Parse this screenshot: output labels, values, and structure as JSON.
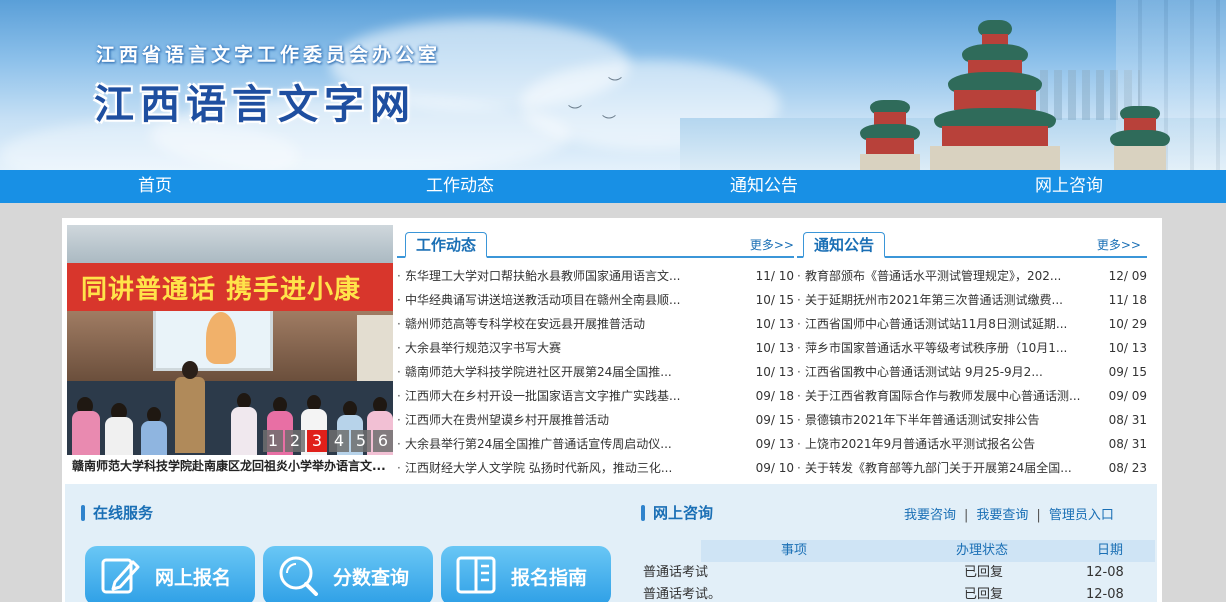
{
  "banner": {
    "subtitle": "江西省语言文字工作委员会办公室",
    "title": "江西语言文字网"
  },
  "nav": {
    "items": [
      {
        "label": "首页"
      },
      {
        "label": "工作动态"
      },
      {
        "label": "通知公告"
      },
      {
        "label": "网上咨询"
      }
    ]
  },
  "slideshow": {
    "banner_text": "同讲普通话  携手进小康",
    "pages": [
      "1",
      "2",
      "3",
      "4",
      "5",
      "6"
    ],
    "active_page": "3",
    "caption": "赣南师范大学科技学院赴南康区龙回祖炎小学举办语言文..."
  },
  "work_news": {
    "title": "工作动态",
    "more": "更多>>",
    "items": [
      {
        "title": "东华理工大学对口帮扶鲐水县教师国家通用语言文...",
        "date": "11/ 10"
      },
      {
        "title": "中华经典诵写讲送培送教活动项目在赣州全南县顺...",
        "date": "10/ 15"
      },
      {
        "title": "赣州师范高等专科学校在安远县开展推普活动",
        "date": "10/ 13"
      },
      {
        "title": "大余县举行规范汉字书写大赛",
        "date": "10/ 13"
      },
      {
        "title": "赣南师范大学科技学院进社区开展第24届全国推...",
        "date": "10/ 13"
      },
      {
        "title": "江西师大在乡村开设一批国家语言文字推广实践基...",
        "date": "09/ 18"
      },
      {
        "title": "江西师大在贵州望谟乡村开展推普活动",
        "date": "09/ 15"
      },
      {
        "title": "大余县举行第24届全国推广普通话宣传周启动仪...",
        "date": "09/ 13"
      },
      {
        "title": "江西财经大学人文学院 弘扬时代新风，推动三化...",
        "date": "09/ 10"
      }
    ]
  },
  "notices": {
    "title": "通知公告",
    "more": "更多>>",
    "items": [
      {
        "title": "教育部颁布《普通话水平测试管理规定》，202...",
        "date": "12/ 09"
      },
      {
        "title": "关于延期抚州市2021年第三次普通话测试缴费...",
        "date": "11/ 18"
      },
      {
        "title": "江西省国师中心普通话测试站11月8日测试延期...",
        "date": "10/ 29"
      },
      {
        "title": "萍乡市国家普通话水平等级考试秩序册（10月1...",
        "date": "10/ 13"
      },
      {
        "title": "江西省国教中心普通话测试站 9月25-9月2...",
        "date": "09/ 15"
      },
      {
        "title": "关于江西省教育国际合作与教师发展中心普通话测...",
        "date": "09/ 09"
      },
      {
        "title": "景德镇市2021年下半年普通话测试安排公告",
        "date": "08/ 31"
      },
      {
        "title": "上饶市2021年9月普通话水平测试报名公告",
        "date": "08/ 31"
      },
      {
        "title": "关于转发《教育部等九部门关于开展第24届全国...",
        "date": "08/ 23"
      }
    ]
  },
  "online_service": {
    "title": "在线服务",
    "buttons": [
      {
        "label": "网上报名",
        "icon": "pencil-edit-icon"
      },
      {
        "label": "分数查询",
        "icon": "search-icon"
      },
      {
        "label": "报名指南",
        "icon": "book-icon"
      }
    ]
  },
  "consult": {
    "title": "网上咨询",
    "links": [
      "我要咨询",
      "我要查询",
      "管理员入口"
    ],
    "columns": [
      "事项",
      "办理状态",
      "日期"
    ],
    "rows": [
      {
        "item": "普通话考试",
        "status": "已回复",
        "date": "12-08"
      },
      {
        "item": "普通话考试。",
        "status": "已回复",
        "date": "12-08"
      }
    ]
  },
  "colors": {
    "nav_bg": "#1890e5",
    "accent": "#1a6fb5",
    "active_page": "#e0201a",
    "page_bg": "#d7d7d7"
  }
}
